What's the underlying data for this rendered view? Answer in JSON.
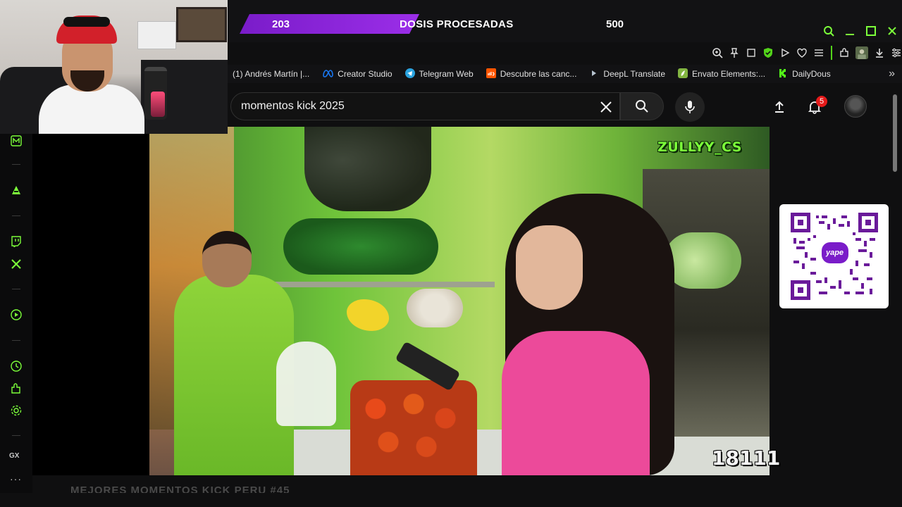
{
  "banner": {
    "left_value": "203",
    "label": "DOSIS PROCESADAS",
    "right_value": "500",
    "accent_color": "#8b25d8"
  },
  "window_controls": [
    "search-icon",
    "minimize-icon",
    "maximize-icon",
    "close-icon"
  ],
  "toolbar_icons": [
    "zoom-icon",
    "pin-icon",
    "crop-icon",
    "shield-icon",
    "play-icon",
    "heart-icon",
    "menu-icon",
    "extensions-icon",
    "profile-icon",
    "download-icon",
    "settings-icon"
  ],
  "bookmarks": [
    {
      "label": "(1) Andrés Martín |...",
      "icon": "page-icon",
      "color": "#555555"
    },
    {
      "label": "Creator Studio",
      "icon": "meta-icon",
      "color": "#1877f2"
    },
    {
      "label": "Telegram Web",
      "icon": "telegram-icon",
      "color": "#2aa3df"
    },
    {
      "label": "Descubre las canc...",
      "icon": "soundcloud-icon",
      "color": "#ff5500"
    },
    {
      "label": "DeepL Translate",
      "icon": "deepl-icon",
      "color": "#0f2b46"
    },
    {
      "label": "Envato Elements:...",
      "icon": "envato-icon",
      "color": "#82b541"
    },
    {
      "label": "DailyDous",
      "icon": "kick-icon",
      "color": "#53fc18"
    }
  ],
  "search": {
    "value": "momentos kick 2025"
  },
  "notifications": {
    "count": "5"
  },
  "video": {
    "overlay_name": "ZULLYY_CS",
    "overlay_count": "18111"
  },
  "qr": {
    "brand": "yape"
  },
  "sidebar": {
    "items": [
      "m-icon",
      "sep",
      "aria-icon",
      "sep",
      "twitch-icon",
      "x-icon",
      "sep",
      "player-icon",
      "sep",
      "history-icon",
      "extensions-icon",
      "settings-icon",
      "sep"
    ],
    "gx_label": "GX",
    "more_label": "···",
    "accent_color": "#7cff3a"
  },
  "below_video": {
    "title": "MEJORES MOMENTOS KICK PERU #45"
  }
}
